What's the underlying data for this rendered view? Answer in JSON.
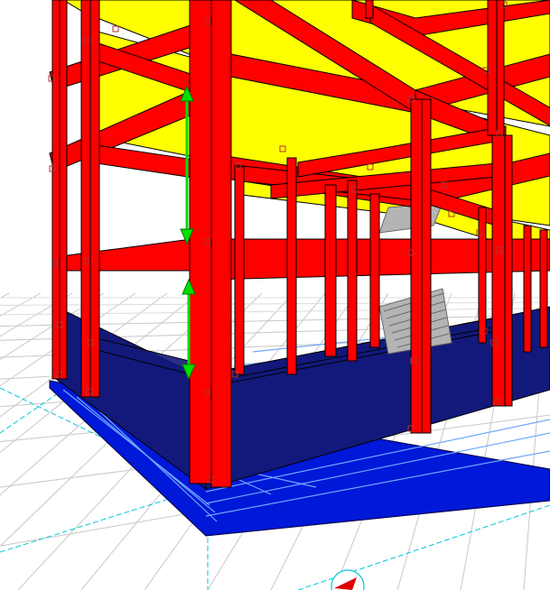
{
  "scene": {
    "kind": "3d-structural-model-view",
    "colors": {
      "background": "#ffffff",
      "ground_grid": "#c8c8c8",
      "ground_grid_far": "#dcdcdc",
      "axis_line": "#00c8d8",
      "foundation_blue": "#0018d8",
      "foundation_edge": "#00003a",
      "foundation_grid_lines": "#6fa8ff",
      "wall_navy": "#13197a",
      "column_red": "#ff0000",
      "beam_red": "#ff0000",
      "member_outline": "#000000",
      "slab_yellow": "#ffff00",
      "stair_grey": "#b4b4b4",
      "dimension_green": "#00e000",
      "node_marker": "#b03030",
      "origin_marker": "#e00000"
    },
    "icons": [
      "dimension-arrow-icon",
      "origin-marker-icon"
    ]
  }
}
